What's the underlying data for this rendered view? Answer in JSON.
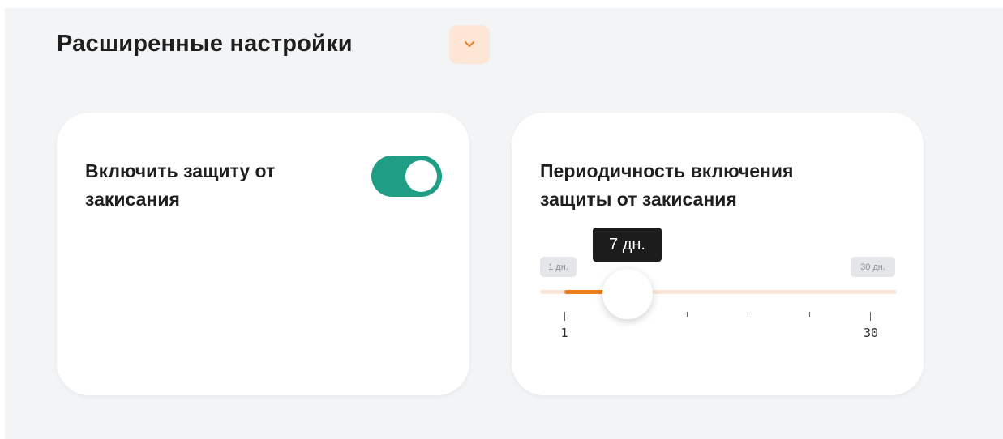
{
  "section": {
    "title": "Расширенные настройки",
    "collapse_icon": "chevron-down-icon",
    "collapse_color": "#fde6d6",
    "chevron_color": "#f07d1a"
  },
  "anti_sticking": {
    "label": "Включить защиту от закисания",
    "enabled": true,
    "toggle_color": "#1f9d85"
  },
  "periodicity": {
    "label": "Периодичность включения защиты от закисания",
    "value_tooltip": "7 дн.",
    "value": 7,
    "min_badge": "1 дн.",
    "max_badge": "30 дн.",
    "min": 1,
    "max": 30,
    "tick_min_label": "1",
    "tick_max_label": "30",
    "fill_color": "#f07d1a",
    "track_color": "#fde6d6"
  }
}
